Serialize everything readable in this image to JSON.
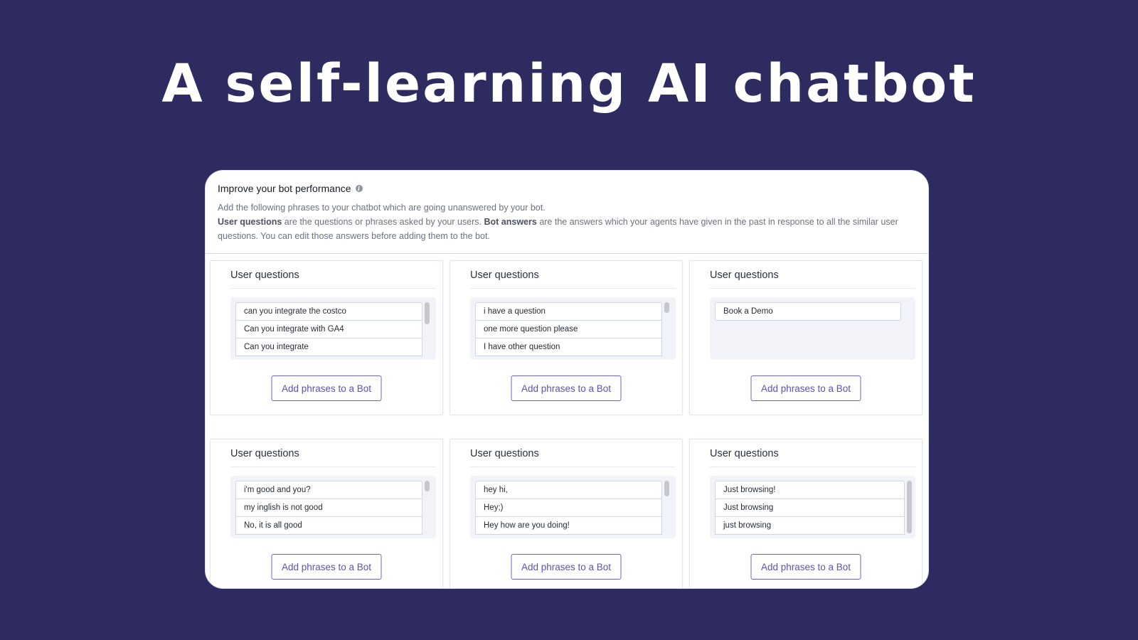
{
  "hero": {
    "title": "A self-learning AI chatbot"
  },
  "panel": {
    "title": "Improve your bot performance",
    "info_icon": "info-icon",
    "desc_line1": "Add the following phrases to your chatbot which are going unanswered by your bot.",
    "desc_bold1": "User questions",
    "desc_part2": " are the questions or phrases asked by your users. ",
    "desc_bold2": "Bot answers",
    "desc_part3": " are the answers which your agents have given in the past in response to all the similar user questions. You can edit those answers before adding them to the bot."
  },
  "cards": [
    {
      "title": "User questions",
      "items": [
        "can you integrate the costco",
        "Can you integrate with GA4",
        "Can you integrate"
      ],
      "button": "Add phrases to a Bot"
    },
    {
      "title": "User questions",
      "items": [
        "i have a question",
        "one more question please",
        "I have other question"
      ],
      "button": "Add phrases to a Bot"
    },
    {
      "title": "User questions",
      "items": [
        "Book a Demo"
      ],
      "button": "Add phrases to a Bot"
    },
    {
      "title": "User questions",
      "items": [
        "i'm good and you?",
        "my inglish is not good",
        "No, it is all good"
      ],
      "button": "Add phrases to a Bot"
    },
    {
      "title": "User questions",
      "items": [
        "hey hi,",
        "Hey;)",
        "Hey how are you doing!"
      ],
      "button": "Add phrases to a Bot"
    },
    {
      "title": "User questions",
      "items": [
        "Just browsing!",
        "Just browsing",
        "just browsing"
      ],
      "button": "Add phrases to a Bot"
    }
  ]
}
